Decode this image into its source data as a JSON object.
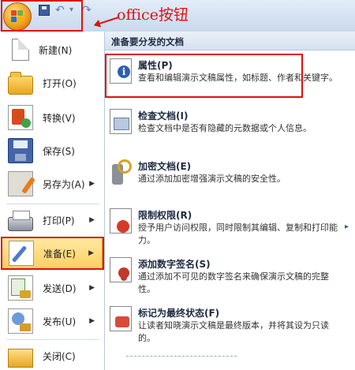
{
  "annotation": {
    "text": "office按钮"
  },
  "qat": {
    "undo_glyph": "↶",
    "redo_glyph": "↷",
    "sep_glyph": "▾"
  },
  "left_menu": {
    "items": [
      {
        "label": "新建(N)",
        "icon": "new-doc-icon"
      },
      {
        "label": "打开(O)",
        "icon": "open-folder-icon"
      },
      {
        "label": "转换(V)",
        "icon": "convert-icon"
      },
      {
        "label": "保存(S)",
        "icon": "save-icon"
      },
      {
        "label": "另存为(A)",
        "icon": "save-as-icon",
        "has_submenu": true
      },
      {
        "label": "打印(P)",
        "icon": "print-icon",
        "has_submenu": true
      },
      {
        "label": "准备(E)",
        "icon": "prepare-icon",
        "has_submenu": true,
        "active": true
      },
      {
        "label": "发送(D)",
        "icon": "send-icon",
        "has_submenu": true
      },
      {
        "label": "发布(U)",
        "icon": "publish-icon",
        "has_submenu": true
      },
      {
        "label": "关闭(C)",
        "icon": "close-icon"
      }
    ],
    "arrow_glyph": "▶"
  },
  "right_panel": {
    "header": "准备要分发的文档",
    "entries": [
      {
        "title": "属性(P)",
        "desc": "查看和编辑演示文稿属性，如标题、作者和关键字。",
        "icon": "properties-icon"
      },
      {
        "title": "检查文档(I)",
        "desc": "检查文档中是否有隐藏的元数据或个人信息。",
        "icon": "inspect-document-icon"
      },
      {
        "title": "加密文档(E)",
        "desc": "通过添加加密增强演示文稿的安全性。",
        "icon": "encrypt-document-icon"
      },
      {
        "title": "限制权限(R)",
        "desc": "授予用户访问权限，同时限制其编辑、复制和打印能力。",
        "icon": "restrict-permission-icon"
      },
      {
        "title": "添加数字签名(S)",
        "desc": "通过添加不可见的数字签名来确保演示文稿的完整性。",
        "icon": "digital-signature-icon"
      },
      {
        "title": "标记为最终状态(F)",
        "desc": "让读者知晓演示文稿是最终版本，并将其设为只读的。",
        "icon": "mark-final-icon"
      }
    ],
    "arrow_glyph": "▸"
  }
}
